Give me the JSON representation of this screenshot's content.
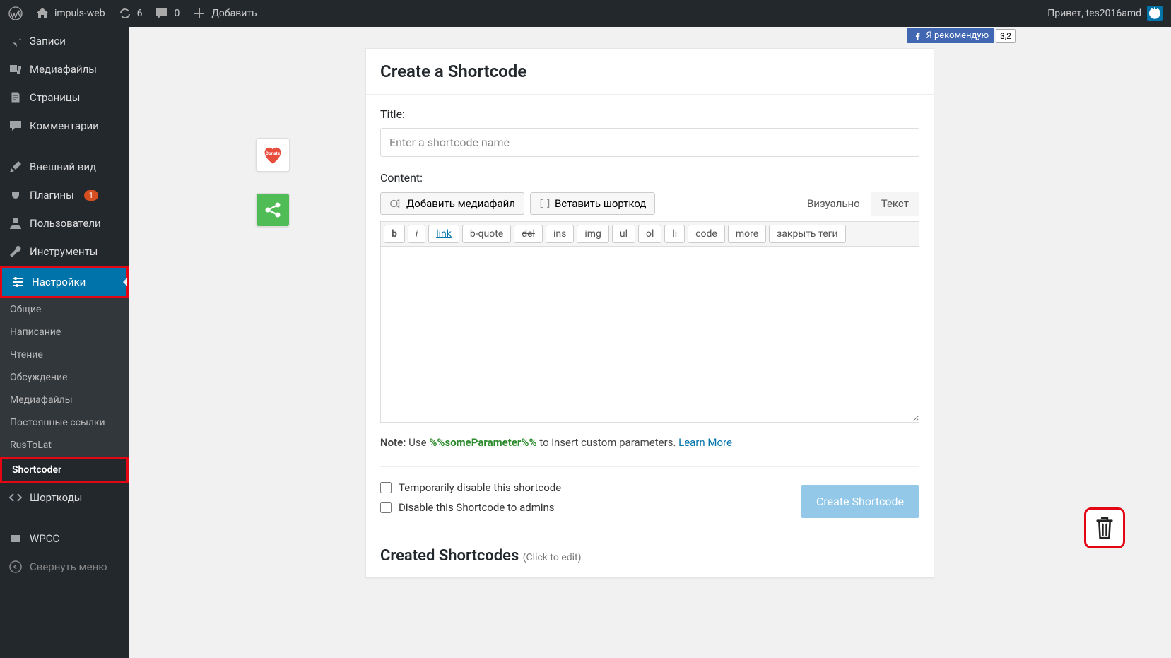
{
  "adminbar": {
    "site_name": "impuls-web",
    "updates_count": "6",
    "comments_count": "0",
    "add_label": "Добавить",
    "greeting": "Привет, tes2016amd"
  },
  "sidebar": {
    "posts": "Записи",
    "media": "Медиафайлы",
    "pages": "Страницы",
    "comments": "Комментарии",
    "appearance": "Внешний вид",
    "plugins": "Плагины",
    "plugins_badge": "1",
    "users": "Пользователи",
    "tools": "Инструменты",
    "settings": "Настройки",
    "submenu": {
      "general": "Общие",
      "writing": "Написание",
      "reading": "Чтение",
      "discussion": "Обсуждение",
      "media": "Медиафайлы",
      "permalinks": "Постоянные ссылки",
      "rustolat": "RusToLat",
      "shortcoder": "Shortcoder"
    },
    "shortcodes": "Шорткоды",
    "wpcc": "WPCC",
    "collapse": "Свернуть меню"
  },
  "fb": {
    "like_text": "Я рекомендую",
    "count": "3,2"
  },
  "panel": {
    "heading": "Create a Shortcode",
    "title_label": "Title:",
    "title_placeholder": "Enter a shortcode name",
    "content_label": "Content:",
    "add_media_btn": "Добавить медиафайл",
    "insert_shortcode_btn": "Вставить шорткод",
    "tab_visual": "Визуально",
    "tab_text": "Текст",
    "qt": {
      "b": "b",
      "i": "i",
      "link": "link",
      "bquote": "b-quote",
      "del": "del",
      "ins": "ins",
      "img": "img",
      "ul": "ul",
      "ol": "ol",
      "li": "li",
      "code": "code",
      "more": "more",
      "close": "закрыть теги"
    },
    "note_prefix": "Note:",
    "note_use": " Use ",
    "note_param": "%%someParameter%%",
    "note_suffix": " to insert custom parameters. ",
    "learn_more": "Learn More",
    "opt_disable_temp": "Temporarily disable this shortcode",
    "opt_disable_admin": "Disable this Shortcode to admins",
    "create_btn": "Create Shortcode",
    "created_heading": "Created Shortcodes",
    "created_hint": "(Click to edit)"
  },
  "float": {
    "donate_text": "Donate"
  }
}
